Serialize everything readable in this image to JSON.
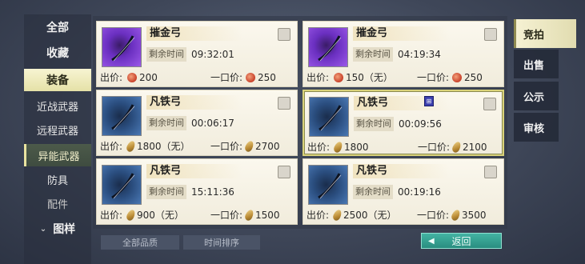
{
  "sidebar": {
    "items": [
      {
        "label": "全部"
      },
      {
        "label": "收藏"
      },
      {
        "label": "装备"
      },
      {
        "label": "近战武器"
      },
      {
        "label": "远程武器"
      },
      {
        "label": "异能武器"
      },
      {
        "label": "防具"
      },
      {
        "label": "配件"
      },
      {
        "label": "图样"
      }
    ]
  },
  "listings": [
    {
      "name": "摧金弓",
      "time_label": "剩余时间",
      "time": "09:32:01",
      "price_label": "出价:",
      "price": "200",
      "buyout_label": "一口价:",
      "buyout": "250",
      "currency": "red-coin-icon",
      "thumb": "purple"
    },
    {
      "name": "摧金弓",
      "time_label": "剩余时间",
      "time": "04:19:34",
      "price_label": "出价:",
      "price": "150（无）",
      "buyout_label": "一口价:",
      "buyout": "250",
      "currency": "red-coin-icon",
      "thumb": "purple"
    },
    {
      "name": "凡铁弓",
      "time_label": "剩余时间",
      "time": "00:06:17",
      "price_label": "出价:",
      "price": "1800（无）",
      "buyout_label": "一口价:",
      "buyout": "2700",
      "currency": "gold-leaf-icon",
      "thumb": "blue"
    },
    {
      "name": "凡铁弓",
      "time_label": "剩余时间",
      "time": "00:09:56",
      "price_label": "出价:",
      "price": "1800",
      "buyout_label": "一口价:",
      "buyout": "2100",
      "currency": "gold-leaf-icon",
      "thumb": "blue"
    },
    {
      "name": "凡铁弓",
      "time_label": "剩余时间",
      "time": "15:11:36",
      "price_label": "出价:",
      "price": "900（无）",
      "buyout_label": "一口价:",
      "buyout": "1500",
      "currency": "gold-leaf-icon",
      "thumb": "blue"
    },
    {
      "name": "凡铁弓",
      "time_label": "剩余时间",
      "time": "00:19:16",
      "price_label": "出价:",
      "price": "2500（无）",
      "buyout_label": "一口价:",
      "buyout": "3500",
      "currency": "gold-leaf-icon",
      "thumb": "blue"
    }
  ],
  "filters": {
    "quality": "全部品质",
    "sort": "时间排序"
  },
  "back_label": "返回",
  "right_tabs": [
    {
      "label": "竞拍"
    },
    {
      "label": "出售"
    },
    {
      "label": "公示"
    },
    {
      "label": "审核"
    }
  ],
  "colors": {
    "card_bg": "#fbf8ee",
    "active_tab": "#f6f2d4",
    "back_button": "#2a8e80",
    "selected_border": "#d9d27a"
  }
}
